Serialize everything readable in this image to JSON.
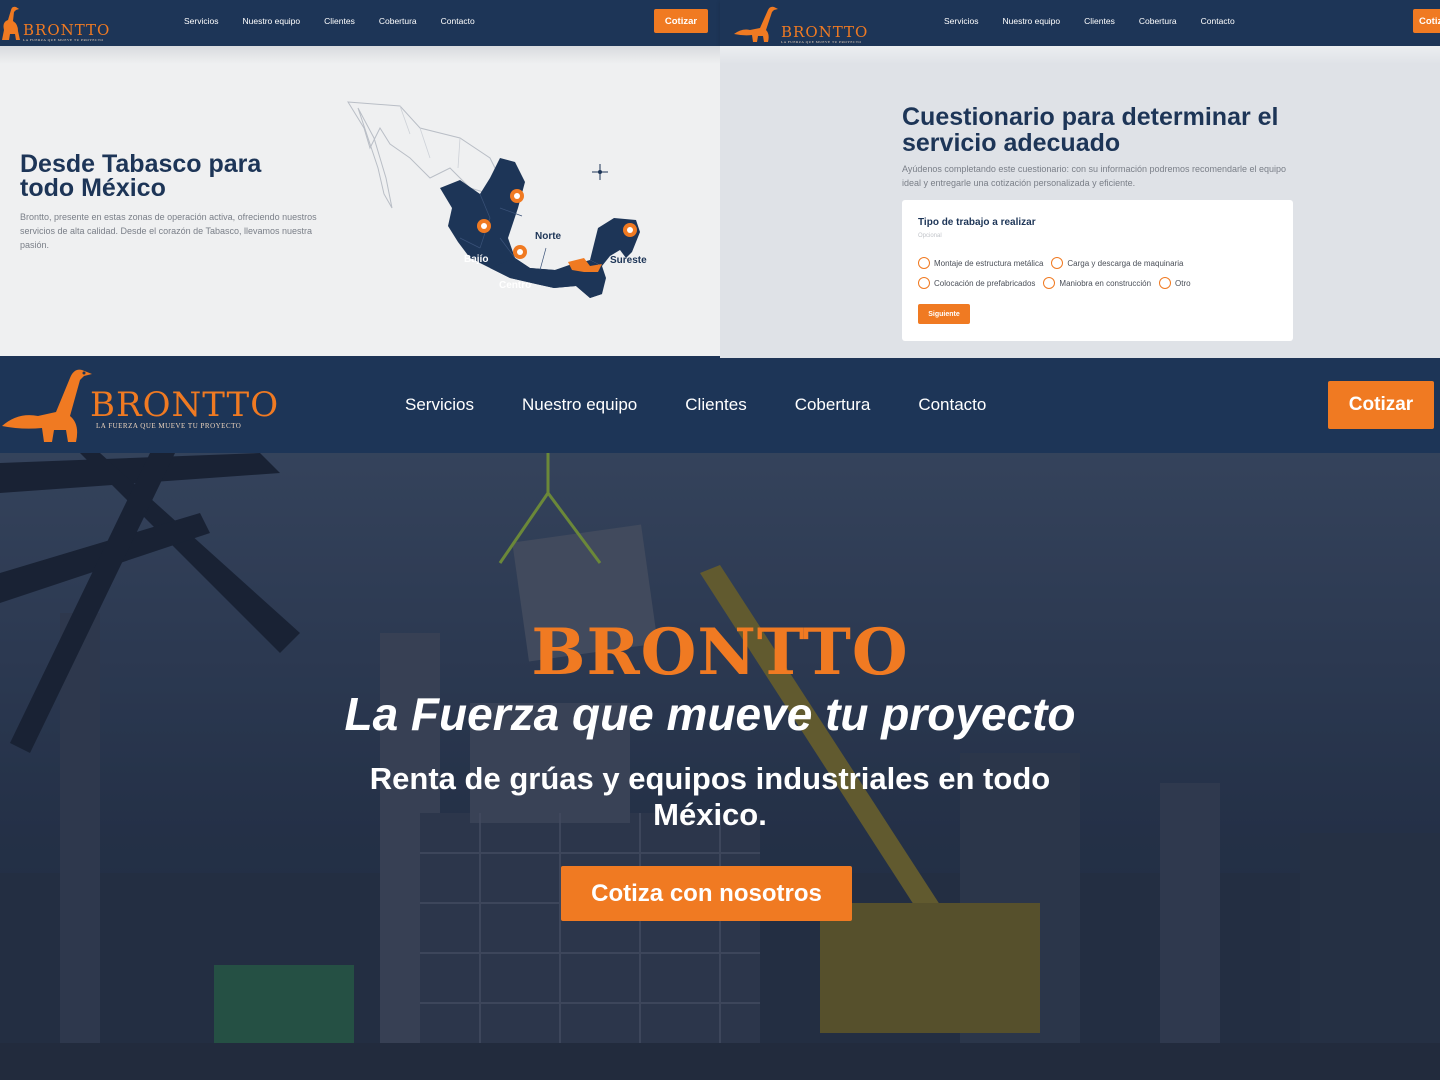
{
  "brand": {
    "logo_word": "BRONTTO",
    "logo_tagline": "LA FUERZA QUE MUEVE TU PROYECTO",
    "accent_color": "#f07a22",
    "navy_color": "#1d3557"
  },
  "nav": {
    "items": [
      "Servicios",
      "Nuestro equipo",
      "Clientes",
      "Cobertura",
      "Contacto"
    ],
    "cta": "Cotizar"
  },
  "coverage": {
    "title": "Desde Tabasco para todo México",
    "body": "Brontto, presente en estas zonas de operación activa, ofreciendo nuestros servicios de alta calidad. Desde el corazón de Tabasco, llevamos nuestra pasión.",
    "regions": [
      "Norte",
      "Bajío",
      "Centro",
      "Sureste"
    ]
  },
  "questionnaire": {
    "title": "Cuestionario para determinar el servicio adecuado",
    "lead": "Ayúdenos completando este cuestionario: con su información podremos recomendarle el equipo ideal y entregarle una cotización personalizada y eficiente.",
    "question": "Tipo de trabajo a realizar",
    "optional_hint": "Opcional",
    "options_row1": [
      "Montaje de estructura metálica",
      "Carga y descarga de maquinaria"
    ],
    "options_row2": [
      "Colocación de prefabricados",
      "Maniobra en construcción",
      "Otro"
    ],
    "next_button": "Siguiente"
  },
  "hero": {
    "brand": "BRONTTO",
    "tagline": "La Fuerza que mueve tu proyecto",
    "subtitle": "Renta de grúas y equipos industriales en todo México.",
    "cta": "Cotiza con nosotros"
  }
}
